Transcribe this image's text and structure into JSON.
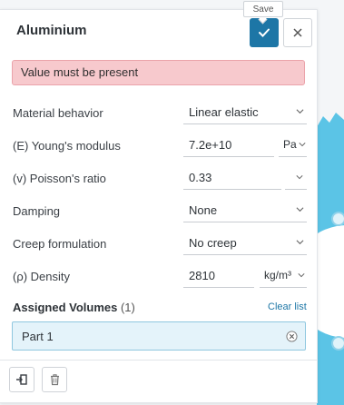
{
  "panel": {
    "title": "Aluminium",
    "tooltip": "Save",
    "confirm_icon": "checkmark-icon",
    "close_icon": "close-icon"
  },
  "alert": {
    "message": "Value must be present"
  },
  "properties": [
    {
      "label": "Material behavior",
      "value": "Linear elastic",
      "unit": ""
    },
    {
      "label": "(E) Young's modulus",
      "value": "7.2e+10",
      "unit": "Pa"
    },
    {
      "label": "(v) Poisson's ratio",
      "value": "0.33",
      "unit": ""
    },
    {
      "label": "Damping",
      "value": "None",
      "unit": ""
    },
    {
      "label": "Creep formulation",
      "value": "No creep",
      "unit": ""
    },
    {
      "label": "(ρ) Density",
      "value": "2810",
      "unit": "kg/m³"
    }
  ],
  "assigned": {
    "label": "Assigned Volumes",
    "count": "(1)",
    "clear_label": "Clear list",
    "items": [
      {
        "label": "Part 1"
      }
    ]
  },
  "footer": {
    "buttons": [
      {
        "icon": "import-icon"
      },
      {
        "icon": "trash-icon"
      }
    ]
  },
  "colors": {
    "accent": "#1d76a6",
    "alert_bg": "#f7c9cd",
    "selection_bg": "#e4f3fa",
    "gear": "#5bc4e6"
  }
}
